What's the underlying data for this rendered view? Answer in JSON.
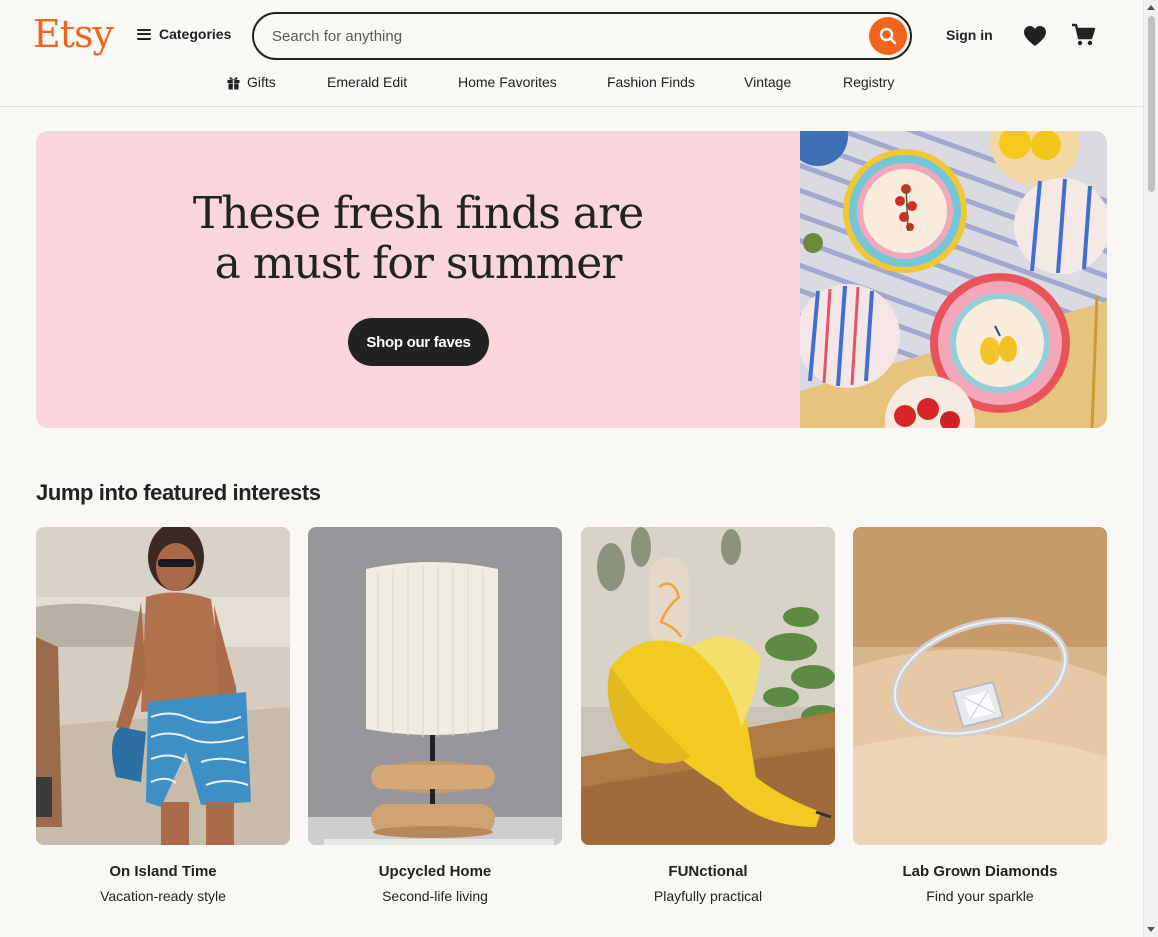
{
  "header": {
    "logo": "Etsy",
    "categories_label": "Categories",
    "search_placeholder": "Search for anything",
    "sign_in_label": "Sign in"
  },
  "nav": {
    "items": [
      {
        "label": "Gifts",
        "icon": "gift-icon"
      },
      {
        "label": "Emerald Edit"
      },
      {
        "label": "Home Favorites"
      },
      {
        "label": "Fashion Finds"
      },
      {
        "label": "Vintage"
      },
      {
        "label": "Registry"
      }
    ]
  },
  "hero": {
    "title_line1": "These fresh finds are",
    "title_line2": "a must for summer",
    "button_label": "Shop our faves",
    "background_color": "#f8d6db"
  },
  "featured": {
    "title": "Jump into featured interests",
    "cards": [
      {
        "title": "On Island Time",
        "subtitle": "Vacation-ready style"
      },
      {
        "title": "Upcycled Home",
        "subtitle": "Second-life living"
      },
      {
        "title": "FUNctional",
        "subtitle": "Playfully practical"
      },
      {
        "title": "Lab Grown Diamonds",
        "subtitle": "Find your sparkle"
      }
    ]
  },
  "colors": {
    "brand_orange": "#f1641e",
    "text_dark": "#222222",
    "page_bg": "#faf8f5"
  }
}
